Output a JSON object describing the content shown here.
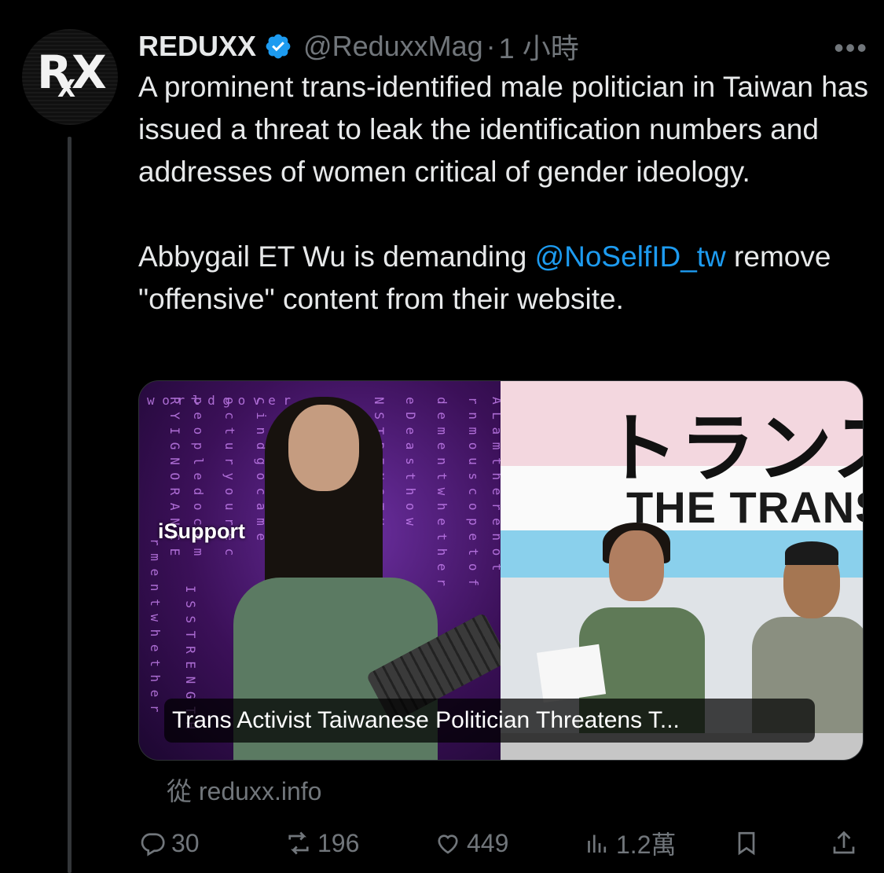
{
  "post": {
    "author_name": "REDUXX",
    "handle": "@ReduxxMag",
    "separator": "·",
    "time": "1 小時",
    "more_label": "•••",
    "avatar_logo": {
      "r": "R",
      "x_big": "X",
      "x_small": "X"
    },
    "text": {
      "p1": "A prominent trans-identified male politician in Taiwan has issued a threat to leak the identification numbers and addresses of women critical of gender ideology.",
      "p2_prefix": "Abbygail ET Wu is demanding ",
      "mention": "@NoSelfID_tw",
      "p2_suffix": " remove \"offensive\" content from their website."
    }
  },
  "link_card": {
    "image_left_label": "iSupport",
    "image_right_jp": "トランスジェ",
    "image_right_en": "THE TRANS",
    "title": "Trans Activist Taiwanese Politician Threatens T...",
    "source": "從 reduxx.info"
  },
  "actions": {
    "replies": "30",
    "reposts": "196",
    "likes": "449",
    "views": "1.2萬"
  },
  "colors": {
    "background": "#000000",
    "text": "#e7e9ea",
    "muted": "#71767b",
    "accent": "#1d9bf0"
  }
}
